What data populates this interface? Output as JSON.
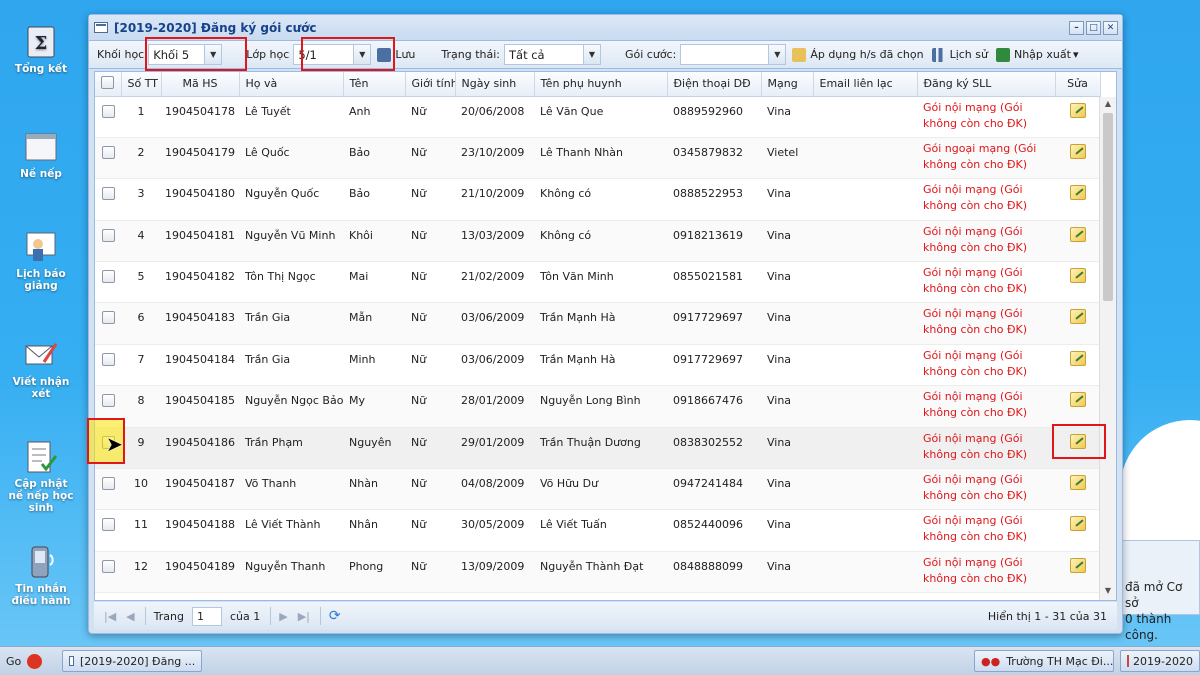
{
  "desktop": {
    "icons": [
      {
        "label": "Tổng kết",
        "icon": "sigma-book-icon"
      },
      {
        "label": "Nề nếp",
        "icon": "window-icon"
      },
      {
        "label": "Lịch báo giảng",
        "icon": "teacher-board-icon"
      },
      {
        "label": "Viết nhận xét",
        "icon": "envelope-pen-icon"
      },
      {
        "label": "Cập nhật nề nếp học sinh",
        "icon": "checklist-icon"
      },
      {
        "label": "Tin nhắn điều hành",
        "icon": "phone-message-icon"
      }
    ]
  },
  "window": {
    "title": "[2019-2020] Đăng ký gói cước"
  },
  "toolbar": {
    "grade_label": "Khối học",
    "grade_value": "Khối 5",
    "class_label": "Lớp học",
    "class_value": "5/1",
    "save_label": "Lưu",
    "status_label": "Trạng thái:",
    "status_value": "Tất cả",
    "package_label": "Gói cước:",
    "package_value": "",
    "apply_label": "Áp dụng h/s đã chọn",
    "history_label": "Lịch sử",
    "import_label": "Nhập xuất",
    "import_arrow": "▾"
  },
  "grid": {
    "columns": [
      "",
      "Số TT",
      "Mã HS",
      "Họ và",
      "Tên",
      "Giới tính",
      "Ngày sinh",
      "Tên phụ huynh",
      "Điện thoại DĐ",
      "Mạng",
      "Email liên lạc",
      "Đăng ký SLL",
      "Sửa"
    ],
    "rows": [
      {
        "stt": "1",
        "ma": "1904504178",
        "ho": "Lê Tuyết",
        "ten": "Anh",
        "gt": "Nữ",
        "ns": "20/06/2008",
        "ph": "Lê Văn Que",
        "dt": "0889592960",
        "mang": "Vina",
        "email": "",
        "dk": "Gói nội mạng (Gói không còn cho ĐK)"
      },
      {
        "stt": "2",
        "ma": "1904504179",
        "ho": "Lê Quốc",
        "ten": "Bảo",
        "gt": "Nữ",
        "ns": "23/10/2009",
        "ph": "Lê Thanh Nhàn",
        "dt": "0345879832",
        "mang": "Vietel",
        "email": "",
        "dk": "Gói ngoại mạng (Gói không còn cho ĐK)"
      },
      {
        "stt": "3",
        "ma": "1904504180",
        "ho": "Nguyễn Quốc",
        "ten": "Bảo",
        "gt": "Nữ",
        "ns": "21/10/2009",
        "ph": "Không có",
        "dt": "0888522953",
        "mang": "Vina",
        "email": "",
        "dk": "Gói nội mạng (Gói không còn cho ĐK)"
      },
      {
        "stt": "4",
        "ma": "1904504181",
        "ho": "Nguyễn Vũ Minh",
        "ten": "Khôi",
        "gt": "Nữ",
        "ns": "13/03/2009",
        "ph": "Không có",
        "dt": "0918213619",
        "mang": "Vina",
        "email": "",
        "dk": "Gói nội mạng (Gói không còn cho ĐK)"
      },
      {
        "stt": "5",
        "ma": "1904504182",
        "ho": "Tôn Thị Ngọc",
        "ten": "Mai",
        "gt": "Nữ",
        "ns": "21/02/2009",
        "ph": "Tôn Văn Minh",
        "dt": "0855021581",
        "mang": "Vina",
        "email": "",
        "dk": "Gói nội mạng (Gói không còn cho ĐK)"
      },
      {
        "stt": "6",
        "ma": "1904504183",
        "ho": "Trần Gia",
        "ten": "Mẫn",
        "gt": "Nữ",
        "ns": "03/06/2009",
        "ph": "Trần Mạnh Hà",
        "dt": "0917729697",
        "mang": "Vina",
        "email": "",
        "dk": "Gói nội mạng (Gói không còn cho ĐK)"
      },
      {
        "stt": "7",
        "ma": "1904504184",
        "ho": "Trần Gia",
        "ten": "Minh",
        "gt": "Nữ",
        "ns": "03/06/2009",
        "ph": "Trần Mạnh Hà",
        "dt": "0917729697",
        "mang": "Vina",
        "email": "",
        "dk": "Gói nội mạng (Gói không còn cho ĐK)"
      },
      {
        "stt": "8",
        "ma": "1904504185",
        "ho": "Nguyễn Ngọc Bảo",
        "ten": "My",
        "gt": "Nữ",
        "ns": "28/01/2009",
        "ph": "Nguyễn Long Bình",
        "dt": "0918667476",
        "mang": "Vina",
        "email": "",
        "dk": "Gói nội mạng (Gói không còn cho ĐK)"
      },
      {
        "stt": "9",
        "ma": "1904504186",
        "ho": "Trần Phạm",
        "ten": "Nguyên",
        "gt": "Nữ",
        "ns": "29/01/2009",
        "ph": "Trần Thuận Dương",
        "dt": "0838302552",
        "mang": "Vina",
        "email": "",
        "dk": "Gói nội mạng (Gói không còn cho ĐK)"
      },
      {
        "stt": "10",
        "ma": "1904504187",
        "ho": "Võ Thanh",
        "ten": "Nhàn",
        "gt": "Nữ",
        "ns": "04/08/2009",
        "ph": "Võ Hữu Dư",
        "dt": "0947241484",
        "mang": "Vina",
        "email": "",
        "dk": "Gói nội mạng (Gói không còn cho ĐK)"
      },
      {
        "stt": "11",
        "ma": "1904504188",
        "ho": "Lê Viết Thành",
        "ten": "Nhân",
        "gt": "Nữ",
        "ns": "30/05/2009",
        "ph": "Lê Viết Tuấn",
        "dt": "0852440096",
        "mang": "Vina",
        "email": "",
        "dk": "Gói nội mạng (Gói không còn cho ĐK)"
      },
      {
        "stt": "12",
        "ma": "1904504189",
        "ho": "Nguyễn Thanh",
        "ten": "Phong",
        "gt": "Nữ",
        "ns": "13/09/2009",
        "ph": "Nguyễn Thành Đạt",
        "dt": "0848888099",
        "mang": "Vina",
        "email": "",
        "dk": "Gói nội mạng (Gói không còn cho ĐK)"
      }
    ]
  },
  "pager": {
    "page_label": "Trang",
    "page_value": "1",
    "of_label": "của 1",
    "info": "Hiển thị 1 - 31 của 31"
  },
  "notification": {
    "line1": "đã mở Cơ sở",
    "line2": "0 thành công."
  },
  "taskbar": {
    "go_label": "Go",
    "task_label": "[2019-2020] Đăng ...",
    "school_label": "Trường TH Mạc Đi...",
    "year_label": "2019-2020"
  },
  "colors": {
    "accent": "#15428b",
    "warning_red": "#e0161a",
    "highlight_box": "#e0161a"
  }
}
